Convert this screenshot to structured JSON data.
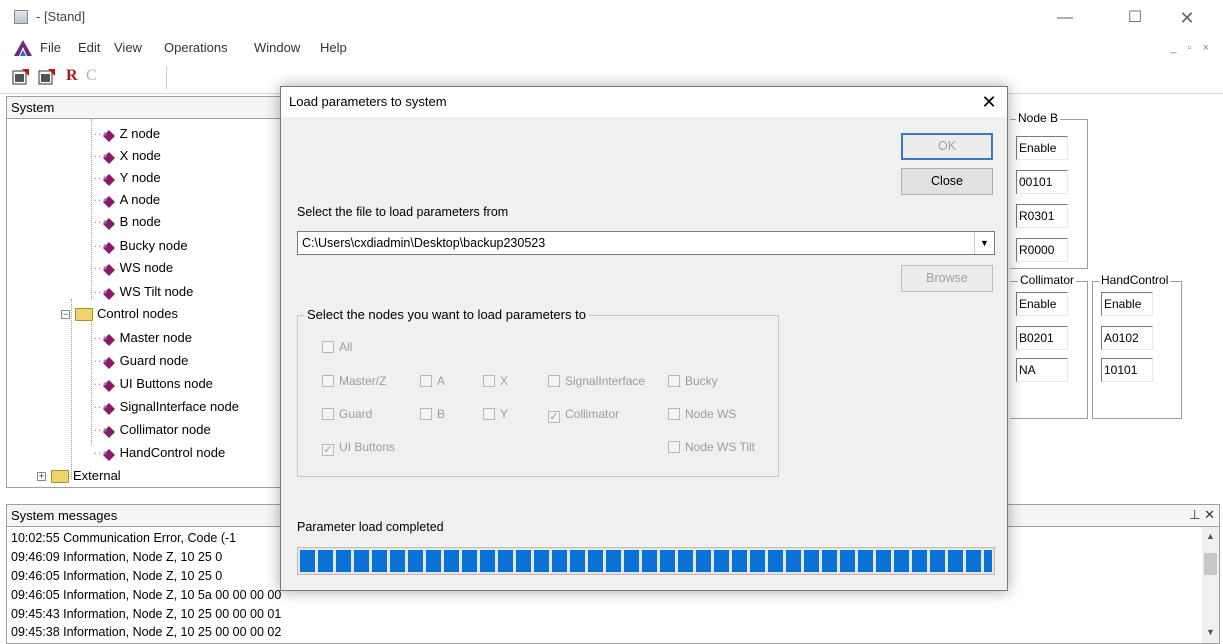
{
  "window": {
    "title": "- [Stand]",
    "minimize": "—",
    "maximize": "☐",
    "close": "✕",
    "mdi_controls": "_ ▫ ×"
  },
  "menu": [
    "File",
    "Edit",
    "View",
    "Operations",
    "Window",
    "Help"
  ],
  "toolbar": {
    "letter_r": "R",
    "letter_c": "C"
  },
  "system_panel": {
    "title": "System",
    "nodes": [
      "Z node",
      "X node",
      "Y node",
      "A node",
      "B node",
      "Bucky node",
      "WS node",
      "WS Tilt node"
    ],
    "control_folder": "Control nodes",
    "control_nodes": [
      "Master node",
      "Guard node",
      "UI Buttons node",
      "SignalInterface node",
      "Collimator node",
      "HandControl node"
    ],
    "external_folder": "External"
  },
  "background": {
    "node_b": {
      "label": "Node B",
      "values": [
        "Enable",
        "00101",
        "R0301",
        "R0000"
      ]
    },
    "collimator": {
      "label": "Collimator",
      "values": [
        "Enable",
        "B0201",
        "NA"
      ]
    },
    "handcontrol": {
      "label": "HandControl",
      "values": [
        "Enable",
        "A0102",
        "10101"
      ]
    }
  },
  "messages": {
    "title": "System messages",
    "pin": "⊥ ✕",
    "lines": [
      "10:02:55 Communication Error, Code (-1",
      "09:46:09 Information, Node Z, 10 25 0",
      "09:46:05 Information, Node Z, 10 25 0",
      "09:46:05 Information, Node Z, 10 5a 00 00 00 00",
      "09:45:43 Information, Node Z, 10 25 00 00 00 01",
      "09:45:38 Information, Node Z, 10 25 00 00 00 02"
    ]
  },
  "dialog": {
    "title": "Load parameters to system",
    "close": "✕",
    "ok_label": "OK",
    "close_label": "Close",
    "file_prompt": "Select the file to load parameters from",
    "file_path": "C:\\Users\\cxdiadmin\\Desktop\\backup230523",
    "browse_label": "Browse",
    "nodes_group_label": "Select the nodes you want to load parameters to",
    "checkboxes": {
      "all": {
        "label": "All",
        "checked": false
      },
      "master_z": {
        "label": "Master/Z",
        "checked": false
      },
      "a": {
        "label": "A",
        "checked": false
      },
      "x": {
        "label": "X",
        "checked": false
      },
      "signal_interface": {
        "label": "SignalInterface",
        "checked": false
      },
      "bucky": {
        "label": "Bucky",
        "checked": false
      },
      "guard": {
        "label": "Guard",
        "checked": false
      },
      "b": {
        "label": "B",
        "checked": false
      },
      "y": {
        "label": "Y",
        "checked": false
      },
      "collimator": {
        "label": "Collimator",
        "checked": true
      },
      "node_ws": {
        "label": "Node WS",
        "checked": false
      },
      "ui_buttons": {
        "label": "UI Buttons",
        "checked": true
      },
      "node_ws_tilt": {
        "label": "Node WS Tilt",
        "checked": false
      }
    },
    "status_text": "Parameter load completed",
    "progress_fraction": 1.0,
    "progress_color": "#0a72d6"
  }
}
